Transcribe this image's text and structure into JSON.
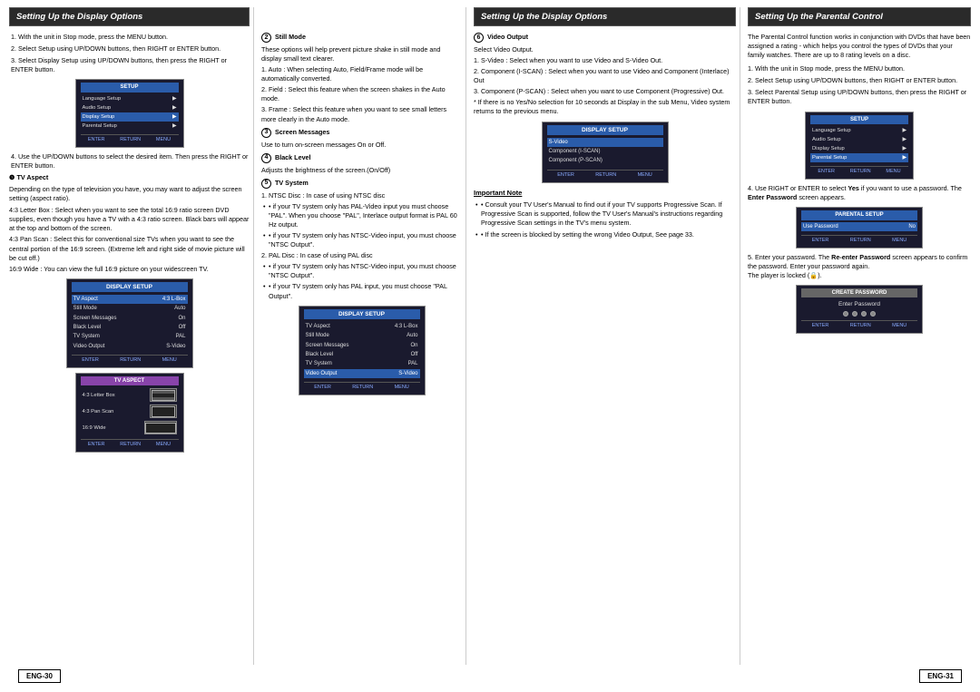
{
  "page": {
    "col1_header": "Setting Up the Display Options",
    "col2_header": "Setting Up the Display Options",
    "col3_header": "Setting Up the Display Options",
    "col4_header": "Setting Up the Parental Control",
    "footer_left": "ENG-30",
    "footer_right": "ENG-31"
  },
  "col1": {
    "steps": [
      "1. With the unit in Stop mode, press the MENU button.",
      "2. Select Setup using UP/DOWN buttons, then RIGHT or ENTER button.",
      "3. Select Display Setup using UP/DOWN buttons, then press the RIGHT or ENTER button."
    ],
    "step4": "4. Use the UP/DOWN buttons to select the desired item. Then press the RIGHT or ENTER button.",
    "tv_aspect_label": "❶ TV Aspect",
    "tv_aspect_text": "Depending on the type of television you have, you may want to adjust the screen setting (aspect ratio).",
    "tv_aspect_items": [
      "4:3 Letter Box : Select when you want to see the total 16:9 ratio screen DVD supplies, even though you have a TV with a 4:3 ratio screen. Black bars will appear at the top and bottom of the screen.",
      "4:3 Pan Scan : Select this for conventional size TVs when you want to see the central portion of the 16:9 screen. (Extreme left and right side of movie picture will be cut off.)",
      "16:9 Wide : You can view the full 16:9 picture on your widescreen TV."
    ]
  },
  "col2": {
    "still_mode_num": "❷",
    "still_mode_label": "Still Mode",
    "still_mode_desc": "These options will help prevent picture shake in still mode and display small text clearer.",
    "still_mode_items": [
      "1. Auto : When selecting Auto, Field/Frame mode will be automatically converted.",
      "2. Field : Select this feature when the screen shakes in the Auto mode.",
      "3. Frame : Select this feature when you want to see small letters more clearly in the Auto mode."
    ],
    "screen_msg_num": "❸",
    "screen_msg_label": "Screen Messages",
    "screen_msg_desc": "Use to turn on-screen messages On or Off.",
    "black_level_num": "❹",
    "black_level_label": "Black Level",
    "black_level_desc": "Adjusts the brightness of the screen.(On/Off)",
    "tv_system_num": "❺",
    "tv_system_label": "TV System",
    "tv_system_items": [
      "1. NTSC Disc : In case of using NTSC disc",
      "• if your TV system only has PAL-Video input you must choose \"PAL\". When you choose \"PAL\", Interlace output format is PAL 60 Hz output.",
      "• if your TV system only has NTSC-Video input, you must choose \"NTSC Output\".",
      "2. PAL Disc : In case of using PAL disc",
      "• if your TV system only has NTSC-Video input, you must choose \"NTSC Output\".",
      "• if your TV system only has PAL input, you must choose \"PAL Output\"."
    ]
  },
  "col3": {
    "video_output_num": "❻",
    "video_output_label": "Video Output",
    "video_output_desc": "Select Video Output.",
    "video_output_items": [
      "1. S-Video : Select when you want to use Video and S-Video Out.",
      "2. Component (I-SCAN) : Select when you want to use Video and Component (Interlace) Out",
      "3. Component (P-SCAN) : Select when you want to use Component (Progressive) Out.",
      "* If there is no Yes/No selection for 10 seconds at Display in the sub Menu, Video system returns to the previous menu."
    ],
    "important_note": "Important Note",
    "note_items": [
      "• Consult your TV User's Manual to find out if your TV supports Progressive Scan. If Progressive Scan is supported, follow the TV User's Manual's instructions regarding Progressive Scan settings in the TV's menu system.",
      "• If the screen is blocked by setting the wrong Video Output, See page 33."
    ]
  },
  "col4": {
    "intro": "The Parental Control function works in conjunction with DVDs that have been assigned a rating - which helps you control the types of DVDs that your family watches. There are up to 8 rating levels on a disc.",
    "steps": [
      "1. With the unit in Stop mode, press the MENU button.",
      "2. Select Setup using UP/DOWN buttons, then RIGHT or ENTER button.",
      "3. Select Parental Setup using UP/DOWN buttons, then press the RIGHT or ENTER button."
    ],
    "step4": "4. Use RIGHT or ENTER to select Yes if you want to use a password. The Enter Password screen appears.",
    "step5_a": "5. Enter your password. The",
    "step5_b": "Re-enter Password",
    "step5_c": "screen appears to confirm the password. Enter your password again.",
    "step5_d": "The player is locked (🔒)."
  },
  "screens": {
    "menu_setup": {
      "title": "SETUP",
      "rows": [
        {
          "label": "Language Setup",
          "value": "▶",
          "selected": false
        },
        {
          "label": "Audio Setup",
          "value": "▶",
          "selected": false
        },
        {
          "label": "Display Setup",
          "value": "▶",
          "selected": false
        },
        {
          "label": "Parental Setup",
          "value": "▶",
          "selected": false
        }
      ]
    },
    "display_setup_full": {
      "title": "DISPLAY SETUP",
      "rows": [
        {
          "label": "TV Aspect",
          "value": "4:3 L-Box"
        },
        {
          "label": "Still Mode",
          "value": "Auto"
        },
        {
          "label": "Screen Messages",
          "value": "On"
        },
        {
          "label": "Black Level",
          "value": "Off"
        },
        {
          "label": "TV System",
          "value": "PAL"
        },
        {
          "label": "Video Output",
          "value": "S-Video"
        }
      ]
    },
    "display_setup_partial": {
      "title": "DISPLAY SETUP",
      "rows": [
        {
          "label": "S-Video",
          "value": ""
        },
        {
          "label": "Component (I-SCAN)",
          "value": ""
        },
        {
          "label": "Component (P-SCAN)",
          "value": ""
        }
      ]
    },
    "tv_aspect": {
      "title": "TV ASPECT",
      "rows": [
        {
          "label": "4:3 Letter Box",
          "icon": true
        },
        {
          "label": "4:3 Pan Scan",
          "icon": true
        },
        {
          "label": "16:9 Wide",
          "icon": true
        }
      ]
    },
    "parental_setup": {
      "title": "PARENTAL SETUP",
      "rows": [
        {
          "label": "Use Password",
          "value": "No"
        }
      ]
    },
    "menu_setup2": {
      "title": "SETUP",
      "rows": [
        {
          "label": "Language Setup",
          "value": "▶",
          "selected": false
        },
        {
          "label": "Audio Setup",
          "value": "▶",
          "selected": false
        },
        {
          "label": "Display Setup",
          "value": "▶",
          "selected": false
        },
        {
          "label": "Parental Setup",
          "value": "▶",
          "selected": true
        }
      ]
    },
    "create_password": {
      "title": "CREATE PASSWORD",
      "label": "Enter Password"
    }
  }
}
